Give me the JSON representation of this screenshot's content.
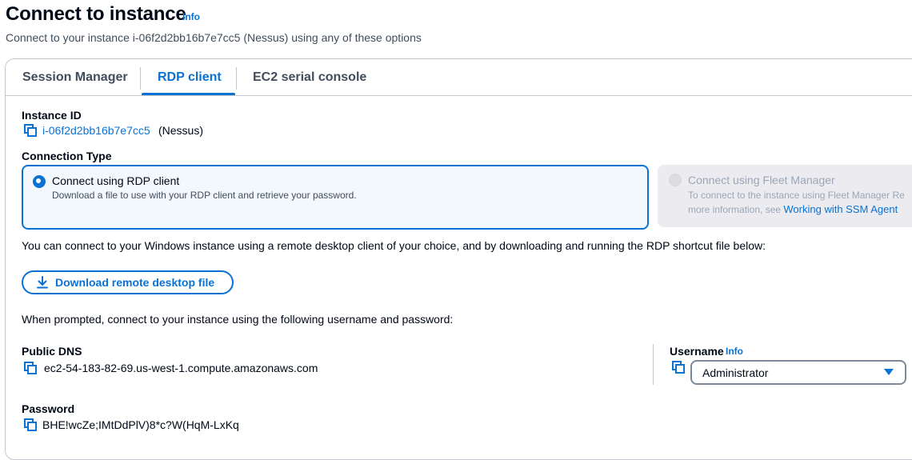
{
  "header": {
    "title": "Connect to instance",
    "info_label": "Info",
    "subtitle": "Connect to your instance i-06f2d2bb16b7e7cc5 (Nessus) using any of these options"
  },
  "tabs": [
    {
      "label": "Session Manager",
      "active": false
    },
    {
      "label": "RDP client",
      "active": true
    },
    {
      "label": "EC2 serial console",
      "active": false
    }
  ],
  "instance": {
    "label": "Instance ID",
    "id": "i-06f2d2bb16b7e7cc5",
    "name": "(Nessus)"
  },
  "connection_type": {
    "label": "Connection Type",
    "options": [
      {
        "title": "Connect using RDP client",
        "description": "Download a file to use with your RDP client and retrieve your password.",
        "selected": true,
        "disabled": false
      },
      {
        "title": "Connect using Fleet Manager",
        "description_line1": "To connect to the instance using Fleet Manager Re",
        "description_line2": "more information, see ",
        "link": "Working with SSM Agent",
        "selected": false,
        "disabled": true
      }
    ]
  },
  "rdp": {
    "description": "You can connect to your Windows instance using a remote desktop client of your choice, and by downloading and running the RDP shortcut file below:",
    "download_label": "Download remote desktop file",
    "prompt": "When prompted, connect to your instance using the following username and password:"
  },
  "public_dns": {
    "label": "Public DNS",
    "value": "ec2-54-183-82-69.us-west-1.compute.amazonaws.com"
  },
  "username": {
    "label": "Username",
    "info_label": "Info",
    "value": "Administrator"
  },
  "password": {
    "label": "Password",
    "value": "BHE!wcZe;IMtDdPlV)8*c?W(HqM-LxKq"
  },
  "colors": {
    "accent": "#0972d3",
    "text": "#000716",
    "muted": "#414d5c",
    "disabled": "#9ba7b6",
    "border": "#c6c6cd"
  },
  "icons": {
    "copy": "copy-icon",
    "download": "download-icon",
    "caret": "caret-down-icon"
  }
}
